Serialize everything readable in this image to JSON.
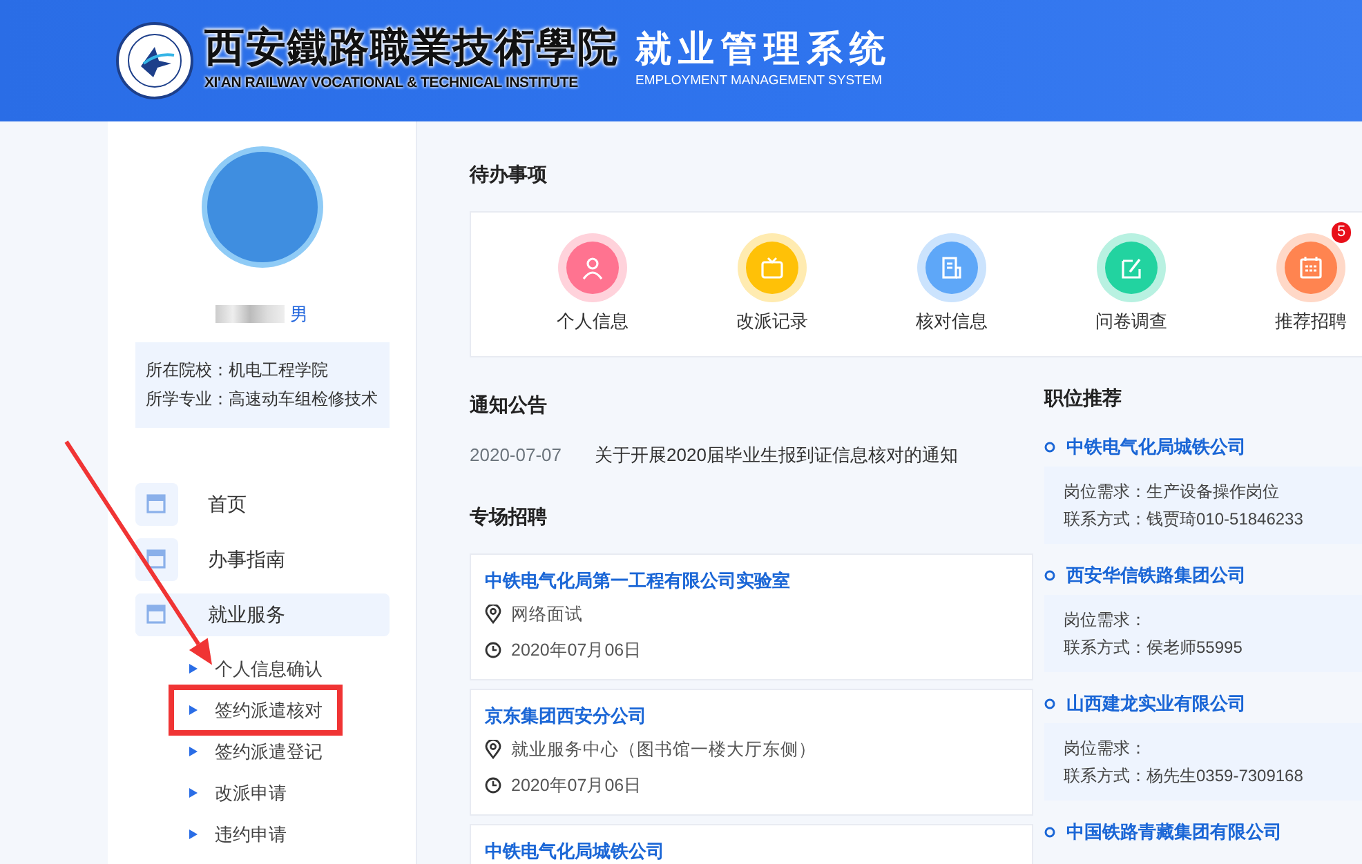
{
  "header": {
    "school_name": "西安鐵路職業技術學院",
    "school_name_en": "XI'AN RAILWAY VOCATIONAL & TECHNICAL INSTITUTE",
    "system_title": "就业管理系统",
    "system_title_en": "EMPLOYMENT MANAGEMENT SYSTEM"
  },
  "profile": {
    "gender": "男",
    "college_label": "所在院校：",
    "college": "机电工程学院",
    "major_label": "所学专业：",
    "major": "高速动车组检修技术"
  },
  "nav": [
    {
      "label": "首页",
      "selected": false
    },
    {
      "label": "办事指南",
      "selected": false
    },
    {
      "label": "就业服务",
      "selected": true,
      "expanded": true,
      "children": [
        {
          "label": "个人信息确认",
          "highlighted": false
        },
        {
          "label": "签约派遣核对",
          "highlighted": true
        },
        {
          "label": "签约派遣登记",
          "highlighted": false
        },
        {
          "label": "改派申请",
          "highlighted": false
        },
        {
          "label": "违约申请",
          "highlighted": false
        }
      ]
    }
  ],
  "todo": {
    "title": "待办事项",
    "items": [
      {
        "label": "个人信息",
        "kind": "person",
        "color": "#ff7390"
      },
      {
        "label": "改派记录",
        "kind": "tv",
        "color": "#ffc107"
      },
      {
        "label": "核对信息",
        "kind": "document",
        "color": "#5ea7f8"
      },
      {
        "label": "问卷调查",
        "kind": "edit",
        "color": "#22d3a0"
      },
      {
        "label": "推荐招聘",
        "kind": "calendar",
        "color": "#ff8450",
        "badge": "5"
      }
    ]
  },
  "notices": {
    "title": "通知公告",
    "items": [
      {
        "date": "2020-07-07",
        "title": "关于开展2020届毕业生报到证信息核对的通知"
      }
    ]
  },
  "fairs": {
    "title": "专场招聘",
    "items": [
      {
        "company": "中铁电气化局第一工程有限公司实验室",
        "location": "网络面试",
        "date": "2020年07月06日"
      },
      {
        "company": "京东集团西安分公司",
        "location": "就业服务中心（图书馆一楼大厅东侧）",
        "date": "2020年07月06日"
      },
      {
        "company": "中铁电气化局城铁公司"
      }
    ]
  },
  "jobs": {
    "title": "职位推荐",
    "items": [
      {
        "company": "中铁电气化局城铁公司",
        "requirement": "岗位需求：生产设备操作岗位",
        "contact": "联系方式：钱贾琦010-51846233"
      },
      {
        "company": "西安华信铁路集团公司",
        "requirement": "岗位需求：",
        "contact": "联系方式：侯老师55995"
      },
      {
        "company": "山西建龙实业有限公司",
        "requirement": "岗位需求：",
        "contact": "联系方式：杨先生0359-7309168"
      },
      {
        "company": "中国铁路青藏集团有限公司"
      }
    ]
  }
}
